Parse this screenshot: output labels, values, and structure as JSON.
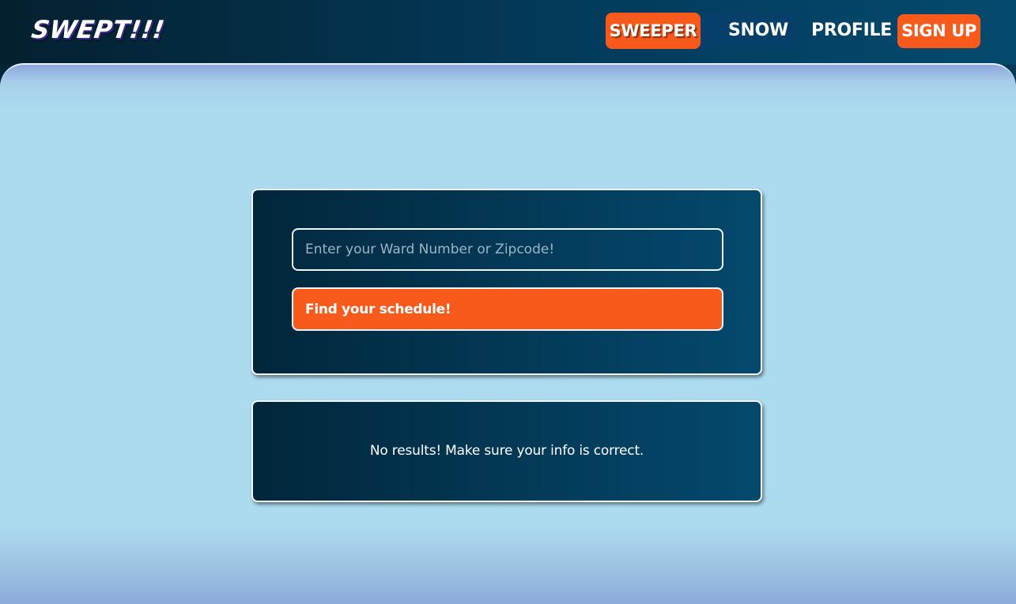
{
  "header": {
    "logo": "SWEPT!!!",
    "toggle": {
      "sweeper_label": "SWEEPER",
      "snow_label": "SNOW",
      "active": "SWEEPER"
    },
    "profile_label": "PROFILE",
    "signup_label": "SIGN UP"
  },
  "search": {
    "placeholder": "Enter your Ward Number or Zipcode!",
    "value": "",
    "button_label": "Find your schedule!"
  },
  "results": {
    "message": "No results! Make sure your info is correct."
  },
  "colors": {
    "accent": "#f85a1c",
    "navy": "#01263a",
    "sky": "#acdaef"
  }
}
